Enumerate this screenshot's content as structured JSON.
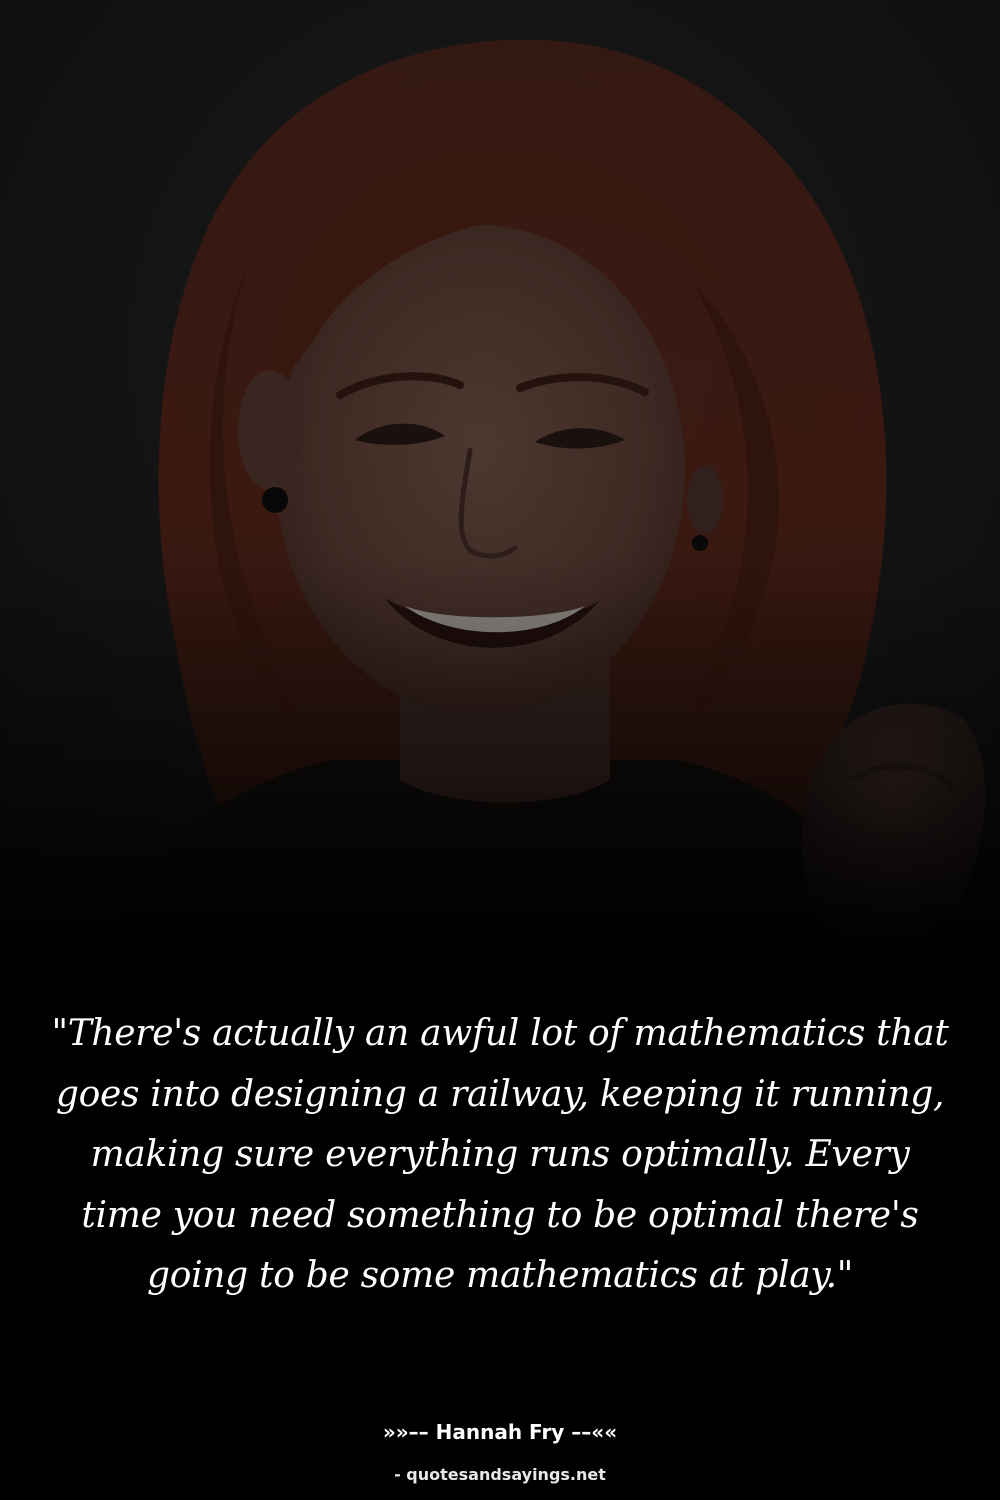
{
  "quote": {
    "text": "\"There's actually an awful lot of mathematics that goes into designing a railway, keeping it running, making sure everything runs optimally. Every time you need something to be optimal there's going to be some mathematics at play.\""
  },
  "attribution": {
    "author_line": "»»–– Hannah Fry ––««",
    "source_line": "- quotesandsayings.net"
  },
  "colors": {
    "background": "#000000",
    "text": "#ffffff",
    "hair": "#7a2e1c",
    "skin": "#6e4a40"
  }
}
